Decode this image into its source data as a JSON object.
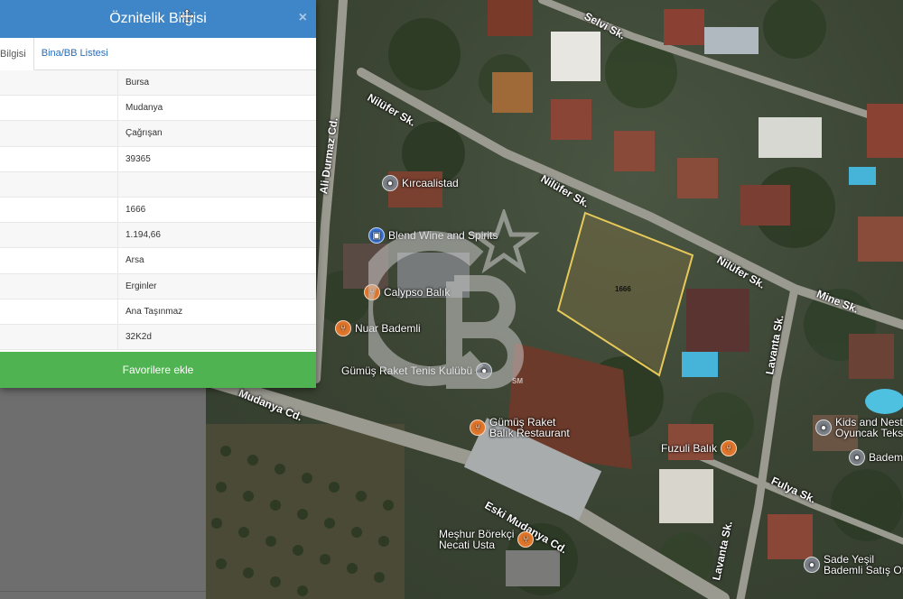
{
  "panel": {
    "title": "Öznitelik Bilgisi",
    "close_glyph": "×",
    "tabs": [
      "Bilgisi",
      "Bina/BB Listesi"
    ],
    "rows": [
      "Bursa",
      "Mudanya",
      "Çağrışan",
      "39365",
      "",
      "1666",
      "1.194,66",
      "Arsa",
      "Erginler",
      "Ana Taşınmaz",
      "32K2d"
    ],
    "favorite_label": "Favorilere ekle"
  },
  "map": {
    "roads": {
      "selvi": "Selvi Sk.",
      "nilufer1": "Nilüfer Sk.",
      "nilufer2": "Nilüfer Sk.",
      "nilufer3": "Nilüfer Sk.",
      "ali_durmaz": "Ali Durmaz Cd.",
      "mine": "Mine Sk.",
      "lavanta1": "Lavanta Sk.",
      "lavanta2": "Lavanta Sk.",
      "fulya": "Fulya Sk.",
      "mudanya": "Mudanya Cd.",
      "eski_mudanya": "Eski Mudanya Cd."
    },
    "pois": {
      "kircaalistad": "Kırcaalistad",
      "blend": "Blend Wine and Spirits",
      "calypso": "Calypso Balık",
      "nuar": "Nuar Bademli",
      "gumus_tenis": "Gümüş Raket Tenis Kulübü",
      "gumus_rest_1": "Gümüş Raket",
      "gumus_rest_2": "Balık Restaurant",
      "fuzuli": "Fuzuli Balık",
      "kids_1": "Kids and Nest",
      "kids_2": "Oyuncak Teks",
      "bademli": "Bademli",
      "meshur_1": "Meşhur Börekçi",
      "meshur_2": "Necati Usta",
      "sade_1": "Sade Yeşil",
      "sade_2": "Bademli Satış Ofi"
    },
    "parcel_label": "1666",
    "watermark_sm": "SM",
    "colors": {
      "parcel_outline": "#e6c95a",
      "header": "#3e86c8",
      "button": "#4fb351"
    }
  }
}
